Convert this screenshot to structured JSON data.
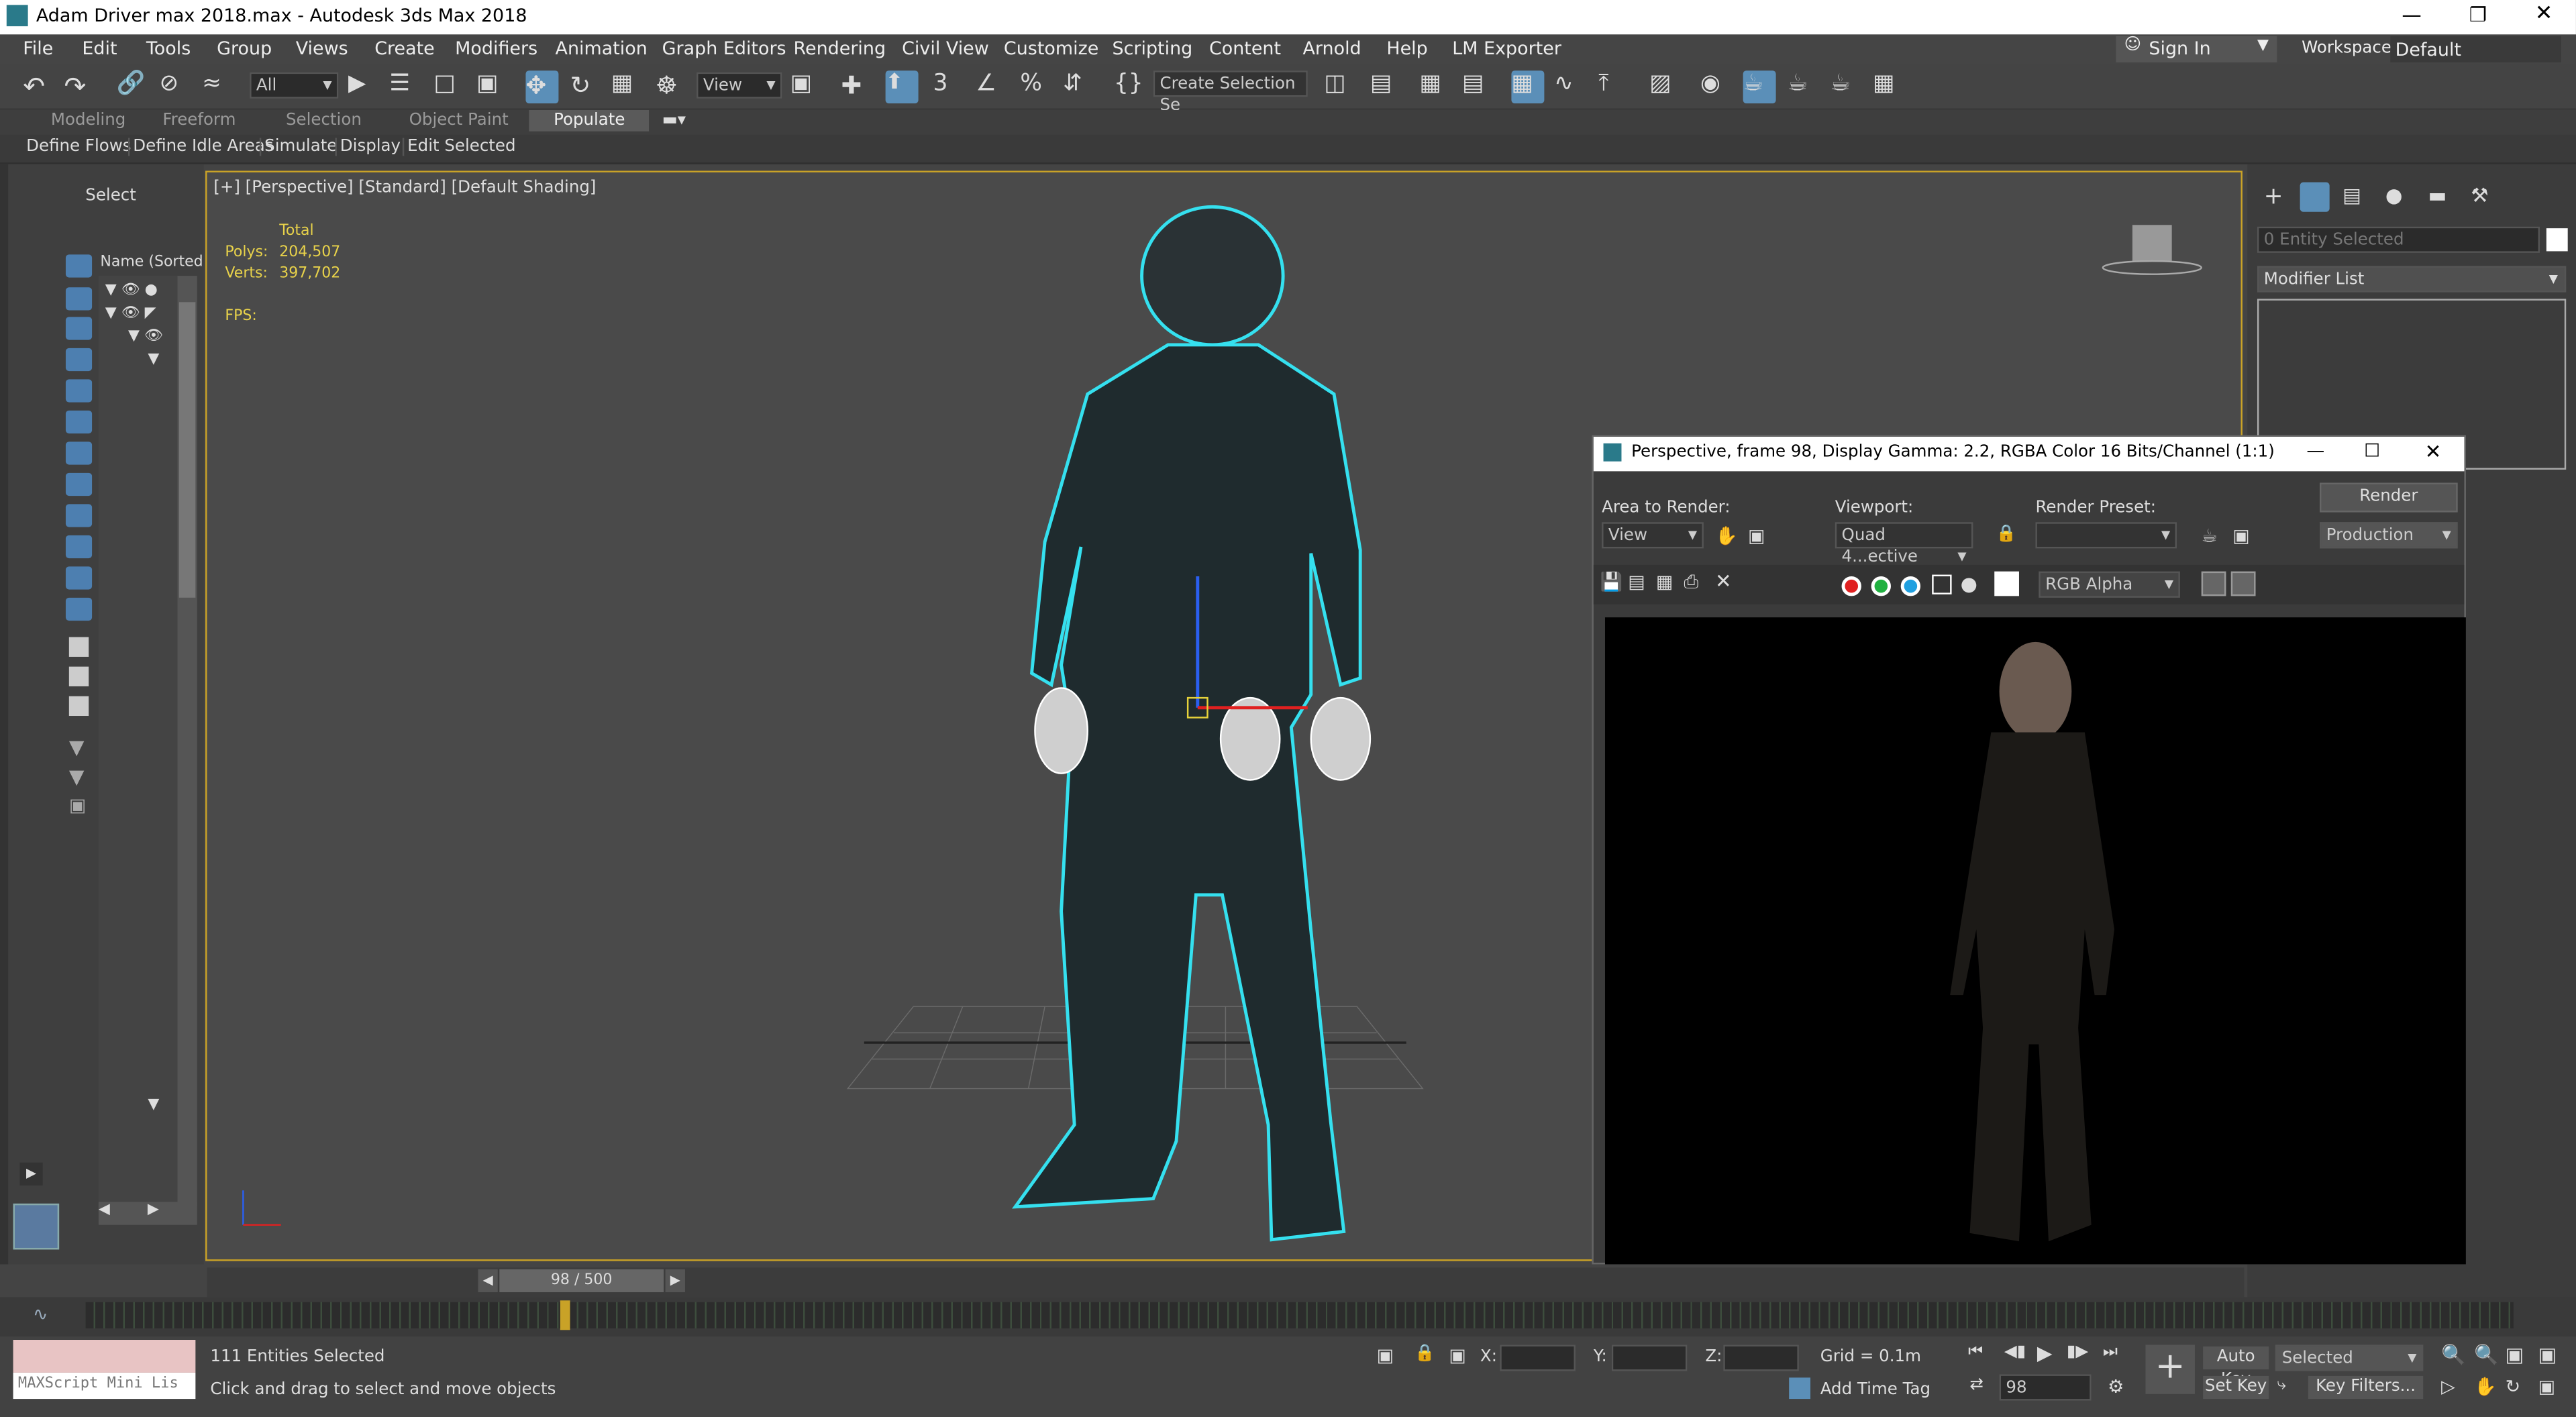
{
  "window": {
    "title": "Adam Driver max 2018.max - Autodesk 3ds Max 2018"
  },
  "menu": [
    "File",
    "Edit",
    "Tools",
    "Group",
    "Views",
    "Create",
    "Modifiers",
    "Animation",
    "Graph Editors",
    "Rendering",
    "Civil View",
    "Customize",
    "Scripting",
    "Content",
    "Arnold",
    "Help",
    "LM Exporter"
  ],
  "account": {
    "sign_in": "Sign In",
    "workspaces_label": "Workspaces:",
    "workspace": "Default"
  },
  "toolbar": {
    "filter": "All",
    "ref_coord": "View",
    "selection_set": "Create Selection Se"
  },
  "ribbon_tabs": [
    "Modeling",
    "Freeform",
    "Selection",
    "Object Paint",
    "Populate"
  ],
  "ribbon_items": [
    "Define Flows",
    "Define Idle Areas",
    "Simulate",
    "Display",
    "Edit Selected"
  ],
  "scene_explorer": {
    "select": "Select",
    "column": "Name (Sorted A"
  },
  "viewport": {
    "label": "[+] [Perspective] [Standard] [Default Shading]",
    "stats_total": "Total",
    "polys_label": "Polys:",
    "polys": "204,507",
    "verts_label": "Verts:",
    "verts": "397,702",
    "fps_label": "FPS:"
  },
  "command_panel": {
    "entity": "0 Entity Selected",
    "modifier_list": "Modifier List"
  },
  "render_window": {
    "title": "Perspective, frame 98, Display Gamma: 2.2, RGBA Color 16 Bits/Channel (1:1)",
    "area_label": "Area to Render:",
    "area": "View",
    "viewport_label": "Viewport:",
    "viewport": "Quad 4...ective",
    "preset_label": "Render Preset:",
    "render_button": "Render",
    "production": "Production",
    "channel": "RGB Alpha",
    "swatch_colors": [
      "#e02020",
      "#20b040",
      "#20a0e0"
    ]
  },
  "timeline": {
    "frame": "98 / 500"
  },
  "status": {
    "maxscript": "MAXScript Mini Lis",
    "entities": "111 Entities Selected",
    "prompt": "Click and drag to select and move objects",
    "x_label": "X:",
    "y_label": "Y:",
    "z_label": "Z:",
    "grid": "Grid = 0.1m",
    "add_time_tag": "Add Time Tag",
    "auto_key": "Auto Key",
    "selected": "Selected",
    "set_key": "Set Key",
    "key_filters": "Key Filters...",
    "frame": "98"
  }
}
